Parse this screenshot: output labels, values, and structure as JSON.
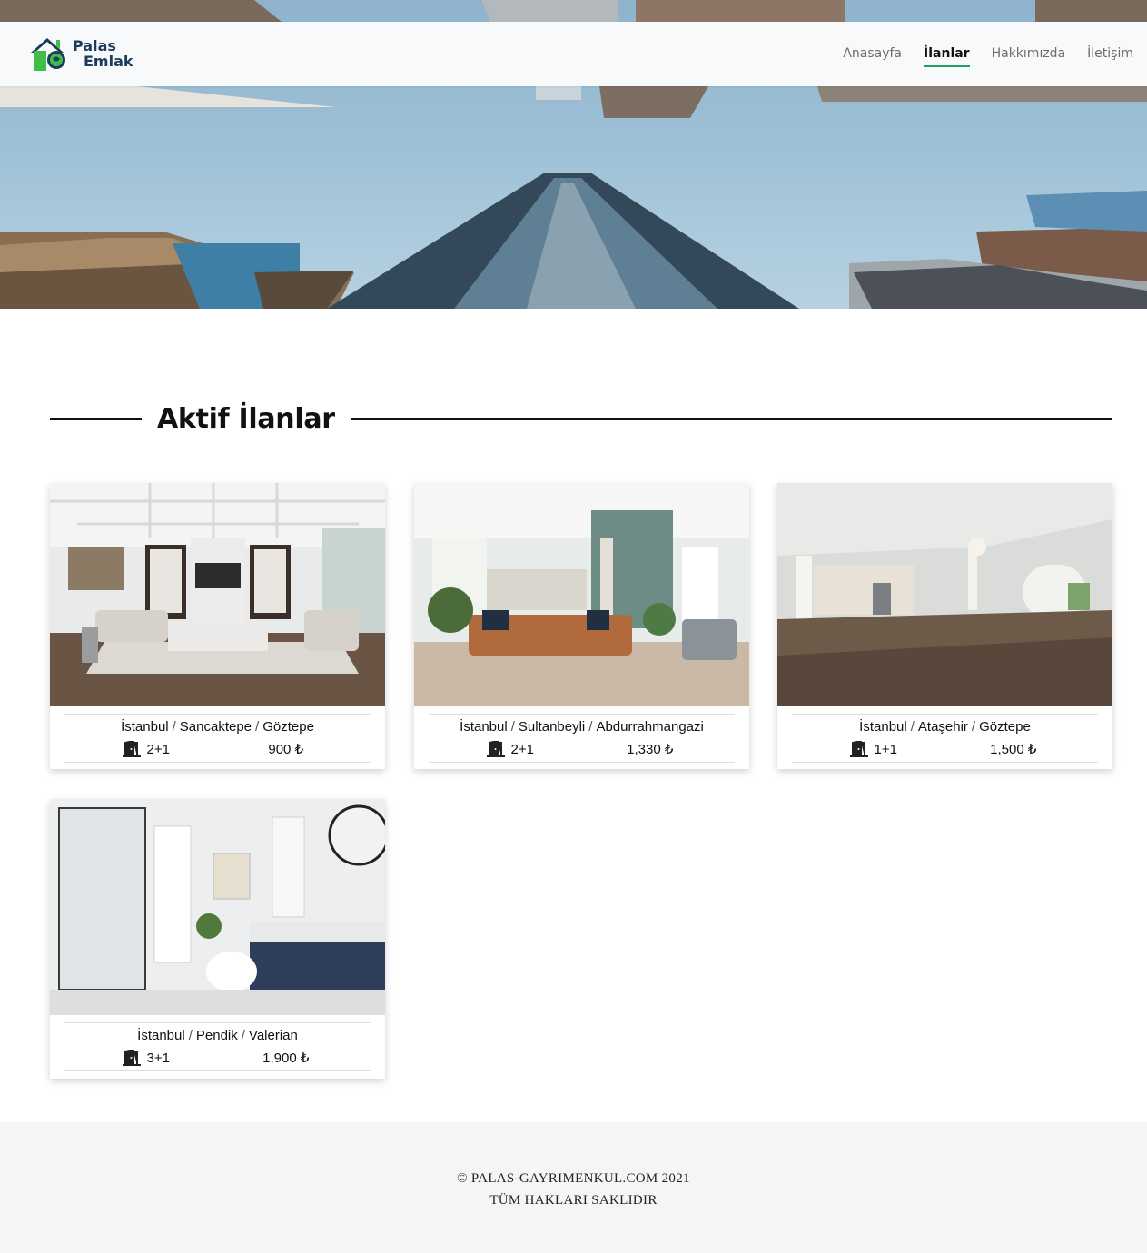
{
  "brand": {
    "line1": "Palas",
    "line2": "Emlak"
  },
  "nav": {
    "items": [
      {
        "label": "Anasayfa",
        "active": false
      },
      {
        "label": "İlanlar",
        "active": true
      },
      {
        "label": "Hakkımızda",
        "active": false
      },
      {
        "label": "İletişim",
        "active": false
      }
    ]
  },
  "section": {
    "title": "Aktif İlanlar"
  },
  "listings": [
    {
      "city": "İstanbul",
      "district": "Sancaktepe",
      "neighborhood": "Göztepe",
      "rooms": "2+1",
      "price": "900 ₺",
      "room_icon": "door-icon"
    },
    {
      "city": "İstanbul",
      "district": "Sultanbeyli",
      "neighborhood": "Abdurrahmangazi",
      "rooms": "2+1",
      "price": "1,330 ₺",
      "room_icon": "door-icon"
    },
    {
      "city": "İstanbul",
      "district": "Ataşehir",
      "neighborhood": "Göztepe",
      "rooms": "1+1",
      "price": "1,500 ₺",
      "room_icon": "door-icon"
    },
    {
      "city": "İstanbul",
      "district": "Pendik",
      "neighborhood": "Valerian",
      "rooms": "3+1",
      "price": "1,900 ₺",
      "room_icon": "door-icon"
    }
  ],
  "separator": "/",
  "footer": {
    "copyright": "© PALAS-GAYRIMENKUL.COM 2021",
    "rights": "TÜM HAKLARI SAKLIDIR"
  },
  "colors": {
    "accent": "#1e9e64",
    "brand_blue": "#1d3b5c",
    "brand_green": "#3fbf4a"
  }
}
